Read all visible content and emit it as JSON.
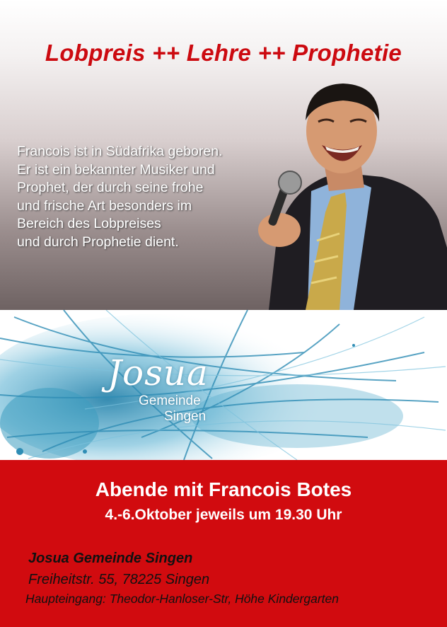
{
  "header": {
    "title": "Lobpreis ++ Lehre ++ Prophetie"
  },
  "bio": {
    "lines": [
      "Francois ist in Südafrika geboren.",
      "Er ist ein bekannter Musiker und",
      "Prophet, der durch seine frohe",
      "und frische Art besonders im",
      "Bereich des Lobpreises",
      "und durch Prophetie dient."
    ]
  },
  "logo": {
    "script": "Josua",
    "line1": "Gemeinde",
    "line2": "Singen"
  },
  "event": {
    "headline": "Abende mit Francois Botes",
    "dates": "4.-6.Oktober jeweils um 19.30 Uhr"
  },
  "address": {
    "name": "Josua Gemeinde Singen",
    "street": "Freiheitstr. 55, 78225 Singen",
    "entrance": "Haupteingang:  Theodor-Hanloser-Str, Höhe Kindergarten"
  },
  "colors": {
    "accent_red": "#d10b0f",
    "title_red": "#cc0a10",
    "splash_blue": "#3d9cc0"
  }
}
